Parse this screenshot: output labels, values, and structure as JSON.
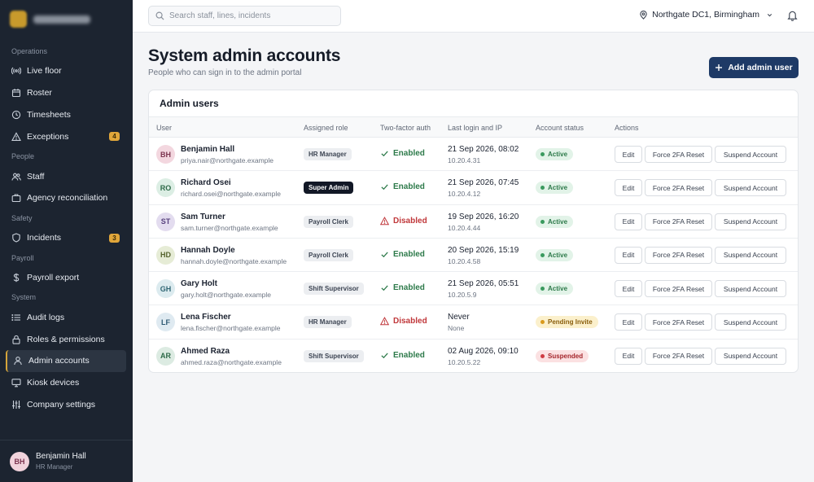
{
  "sidebar": {
    "sections": [
      {
        "title": "Operations",
        "items": [
          {
            "label": "Live floor",
            "icon": "broadcast-icon"
          },
          {
            "label": "Roster",
            "icon": "calendar-icon"
          },
          {
            "label": "Timesheets",
            "icon": "clock-icon"
          },
          {
            "label": "Exceptions",
            "icon": "alert-triangle-icon",
            "badge": "4"
          }
        ]
      },
      {
        "title": "People",
        "items": [
          {
            "label": "Staff",
            "icon": "users-icon"
          },
          {
            "label": "Agency reconciliation",
            "icon": "briefcase-icon"
          }
        ]
      },
      {
        "title": "Safety",
        "items": [
          {
            "label": "Incidents",
            "icon": "shield-icon",
            "badge": "3"
          }
        ]
      },
      {
        "title": "Payroll",
        "items": [
          {
            "label": "Payroll export",
            "icon": "dollar-icon"
          }
        ]
      },
      {
        "title": "System",
        "items": [
          {
            "label": "Audit logs",
            "icon": "list-icon"
          },
          {
            "label": "Roles & permissions",
            "icon": "lock-icon"
          },
          {
            "label": "Admin accounts",
            "icon": "user-icon",
            "active": true
          },
          {
            "label": "Kiosk devices",
            "icon": "monitor-icon"
          },
          {
            "label": "Company settings",
            "icon": "sliders-icon"
          }
        ]
      }
    ],
    "user": {
      "initials": "BH",
      "name": "Benjamin Hall",
      "role": "HR Manager"
    }
  },
  "topbar": {
    "search_placeholder": "Search staff, lines, incidents",
    "location": "Northgate DC1, Birmingham"
  },
  "page": {
    "title": "System admin accounts",
    "subtitle": "People who can sign in to the admin portal",
    "add_button": "Add admin user"
  },
  "table": {
    "title": "Admin users",
    "columns": [
      "User",
      "Assigned role",
      "Two-factor auth",
      "Last login and IP",
      "Account status",
      "Actions"
    ],
    "actions": {
      "edit": "Edit",
      "force_2fa": "Force 2FA Reset",
      "suspend": "Suspend Account"
    },
    "rows": [
      {
        "initials": "BH",
        "name": "Benjamin Hall",
        "email": "priya.nair@northgate.example",
        "role": "HR Manager",
        "role_style": "light",
        "tfa": "Enabled",
        "tfa_ok": true,
        "login": "21 Sep 2026, 08:02",
        "ip": "10.20.4.31",
        "status": "Active",
        "status_kind": "active",
        "avatar_bg": "#f3d7df",
        "avatar_fg": "#7d3550"
      },
      {
        "initials": "RO",
        "name": "Richard Osei",
        "email": "richard.osei@northgate.example",
        "role": "Super Admin",
        "role_style": "dark",
        "tfa": "Enabled",
        "tfa_ok": true,
        "login": "21 Sep 2026, 07:45",
        "ip": "10.20.4.12",
        "status": "Active",
        "status_kind": "active",
        "avatar_bg": "#dceee4",
        "avatar_fg": "#2d6a48"
      },
      {
        "initials": "ST",
        "name": "Sam Turner",
        "email": "sam.turner@northgate.example",
        "role": "Payroll Clerk",
        "role_style": "light",
        "tfa": "Disabled",
        "tfa_ok": false,
        "login": "19 Sep 2026, 16:20",
        "ip": "10.20.4.44",
        "status": "Active",
        "status_kind": "active",
        "avatar_bg": "#e3dcef",
        "avatar_fg": "#57407d"
      },
      {
        "initials": "HD",
        "name": "Hannah Doyle",
        "email": "hannah.doyle@northgate.example",
        "role": "Payroll Clerk",
        "role_style": "light",
        "tfa": "Enabled",
        "tfa_ok": true,
        "login": "20 Sep 2026, 15:19",
        "ip": "10.20.4.58",
        "status": "Active",
        "status_kind": "active",
        "avatar_bg": "#e6ecd6",
        "avatar_fg": "#55632d"
      },
      {
        "initials": "GH",
        "name": "Gary Holt",
        "email": "gary.holt@northgate.example",
        "role": "Shift Supervisor",
        "role_style": "light",
        "tfa": "Enabled",
        "tfa_ok": true,
        "login": "21 Sep 2026, 05:51",
        "ip": "10.20.5.9",
        "status": "Active",
        "status_kind": "active",
        "avatar_bg": "#dcebef",
        "avatar_fg": "#2f6674"
      },
      {
        "initials": "LF",
        "name": "Lena Fischer",
        "email": "lena.fischer@northgate.example",
        "role": "HR Manager",
        "role_style": "light",
        "tfa": "Disabled",
        "tfa_ok": false,
        "login": "Never",
        "ip": "None",
        "status": "Pending Invite",
        "status_kind": "pending",
        "avatar_bg": "#dfeaf1",
        "avatar_fg": "#2f5a74"
      },
      {
        "initials": "AR",
        "name": "Ahmed Raza",
        "email": "ahmed.raza@northgate.example",
        "role": "Shift Supervisor",
        "role_style": "light",
        "tfa": "Enabled",
        "tfa_ok": true,
        "login": "02 Aug 2026, 09:10",
        "ip": "10.20.5.22",
        "status": "Suspended",
        "status_kind": "suspended",
        "avatar_bg": "#dcebe2",
        "avatar_fg": "#2d6a48"
      }
    ]
  },
  "colors": {
    "sidebar_bg": "#1c2430",
    "primary": "#1e3a66",
    "badge": "#e0a63a",
    "enabled": "#2d7a4a",
    "disabled": "#c0373a",
    "active_pill": "#e2f3e8",
    "pending_pill": "#fbf0cc",
    "suspended_pill": "#fbe1e2"
  }
}
